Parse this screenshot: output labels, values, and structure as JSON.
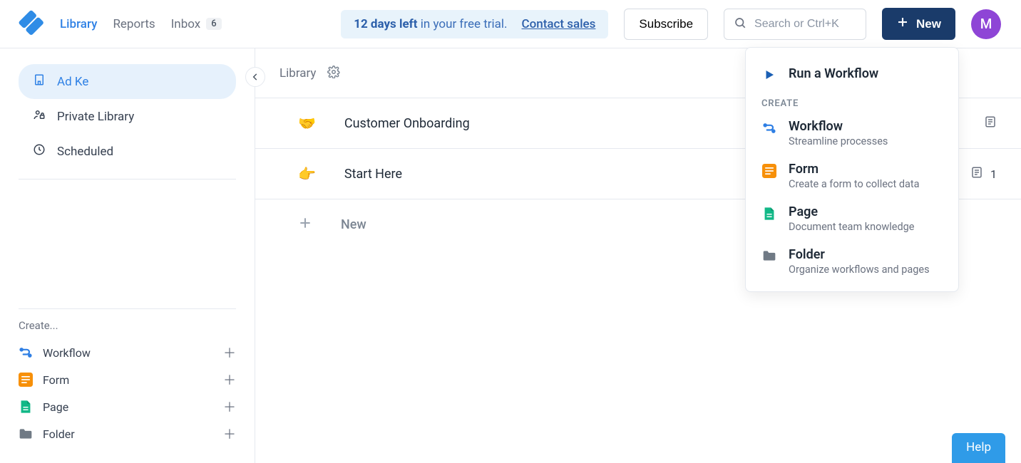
{
  "nav": {
    "library": "Library",
    "reports": "Reports",
    "inbox": "Inbox",
    "inbox_badge": "6"
  },
  "trial": {
    "bold": "12 days left",
    "rest": " in your free trial.",
    "contact": "Contact sales"
  },
  "buttons": {
    "subscribe": "Subscribe",
    "new": "New",
    "help": "Help"
  },
  "search": {
    "placeholder": "Search or Ctrl+K"
  },
  "avatar": {
    "letter": "M"
  },
  "sidebar": {
    "items": [
      {
        "label": "Ad Ke"
      },
      {
        "label": "Private Library"
      },
      {
        "label": "Scheduled"
      }
    ],
    "create_header": "Create...",
    "create": [
      {
        "label": "Workflow"
      },
      {
        "label": "Form"
      },
      {
        "label": "Page"
      },
      {
        "label": "Folder"
      }
    ]
  },
  "main": {
    "title": "Library",
    "rows": [
      {
        "emoji": "🤝",
        "label": "Customer Onboarding",
        "count": ""
      },
      {
        "emoji": "👉",
        "label": "Start Here",
        "count": "1"
      }
    ],
    "new_label": "New"
  },
  "dropdown": {
    "run": "Run a Workflow",
    "create_label": "CREATE",
    "items": [
      {
        "title": "Workflow",
        "sub": "Streamline processes"
      },
      {
        "title": "Form",
        "sub": "Create a form to collect data"
      },
      {
        "title": "Page",
        "sub": "Document team knowledge"
      },
      {
        "title": "Folder",
        "sub": "Organize workflows and pages"
      }
    ]
  }
}
